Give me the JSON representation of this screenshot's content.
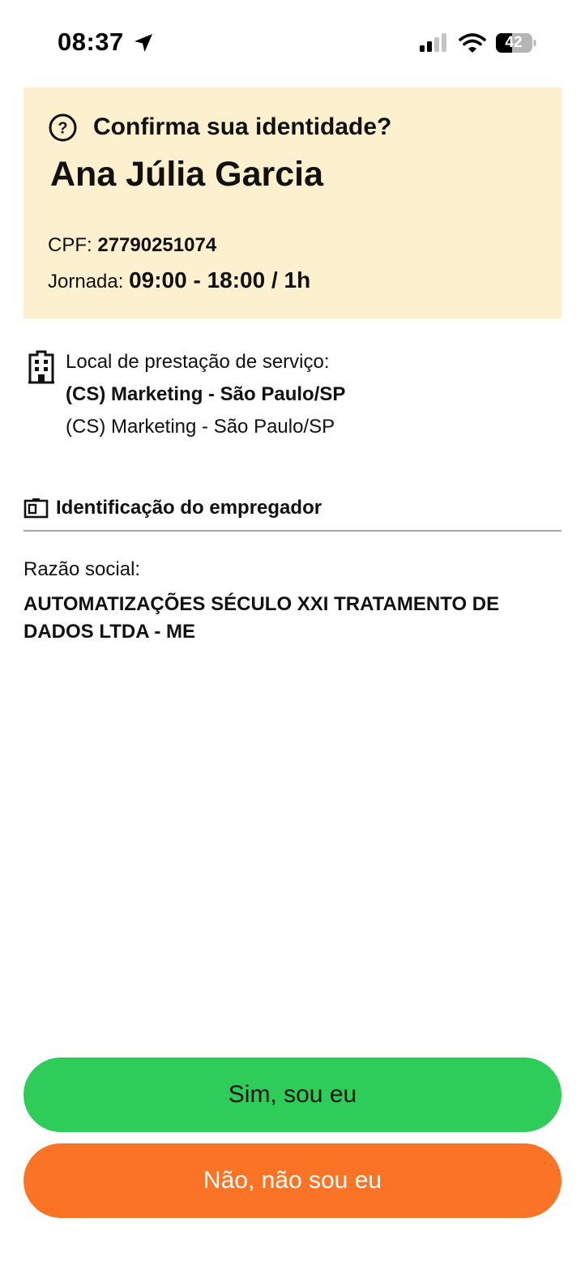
{
  "status_bar": {
    "time": "08:37",
    "battery": "42",
    "icons": [
      "location-arrow-icon",
      "cellular-signal-icon",
      "wifi-icon",
      "battery-icon"
    ]
  },
  "identity": {
    "question": "Confirma sua identidade?",
    "name": "Ana Júlia Garcia",
    "cpf_label": "CPF: ",
    "cpf_value": "27790251074",
    "jornada_label": "Jornada: ",
    "jornada_value": "09:00 - 18:00 / 1h"
  },
  "local": {
    "label": "Local de prestação de serviço:",
    "primary": "(CS) Marketing - São Paulo/SP",
    "secondary": "(CS) Marketing - São Paulo/SP"
  },
  "employer": {
    "heading": "Identificação do empregador",
    "razao_label": "Razão social:",
    "razao_value": "AUTOMATIZAÇÕES SÉCULO XXI TRATAMENTO DE DADOS LTDA - ME"
  },
  "actions": {
    "confirm": "Sim, sou eu",
    "deny": "Não, não sou eu"
  },
  "colors": {
    "card_bg": "#fdf0cf",
    "confirm_bg": "#2ecc58",
    "deny_bg": "#fb7426",
    "divider": "#a6a6a6"
  }
}
